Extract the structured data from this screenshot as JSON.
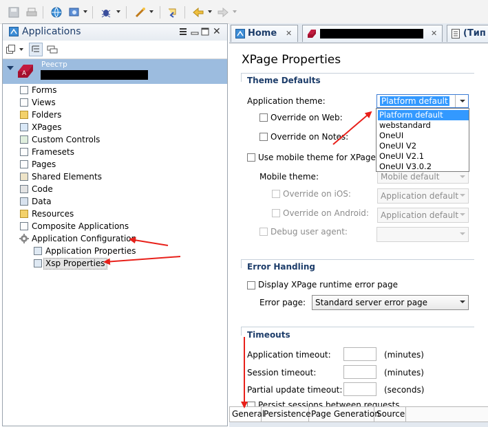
{
  "left_panel": {
    "title": "Applications",
    "app_node": {
      "label": "Реестр"
    },
    "tree_items": [
      {
        "label": "Forms"
      },
      {
        "label": "Views"
      },
      {
        "label": "Folders"
      },
      {
        "label": "XPages"
      },
      {
        "label": "Custom Controls"
      },
      {
        "label": "Framesets"
      },
      {
        "label": "Pages"
      },
      {
        "label": "Shared Elements"
      },
      {
        "label": "Code"
      },
      {
        "label": "Data"
      },
      {
        "label": "Resources"
      },
      {
        "label": "Composite Applications"
      },
      {
        "label": "Application Configuration"
      }
    ],
    "sub_items": [
      {
        "label": "Application Properties"
      },
      {
        "label": "Xsp Properties"
      }
    ]
  },
  "editor_tabs": [
    {
      "label": "Home"
    },
    {
      "label": "(Тип"
    }
  ],
  "page": {
    "title": "XPage Properties",
    "theme_defaults": {
      "title": "Theme Defaults",
      "app_theme_label": "Application theme:",
      "app_theme_value": "Platform default",
      "override_web": "Override on Web:",
      "override_notes": "Override on Notes:",
      "use_mobile": "Use mobile theme for XPages wi",
      "mobile_theme_label": "Mobile theme:",
      "mobile_theme_value": "Mobile default",
      "override_ios": "Override on iOS:",
      "override_ios_value": "Application default",
      "override_android": "Override on Android:",
      "override_android_value": "Application default",
      "debug_agent": "Debug user agent:",
      "theme_options": [
        "Platform default",
        "webstandard",
        "OneUI",
        "OneUI V2",
        "OneUI V2.1",
        "OneUI V3.0.2"
      ]
    },
    "error_handling": {
      "title": "Error Handling",
      "display_label": "Display XPage runtime error page",
      "error_page_label": "Error page:",
      "error_page_value": "Standard server error page"
    },
    "timeouts": {
      "title": "Timeouts",
      "app_timeout": "Application timeout:",
      "session_timeout": "Session timeout:",
      "partial_timeout": "Partial update timeout:",
      "unit_minutes": "(minutes)",
      "unit_seconds": "(seconds)",
      "persist": "Persist sessions between requests"
    }
  },
  "bottom_tabs": [
    "General",
    "Persistence",
    "Page Generation",
    "Source"
  ],
  "colors": {
    "annotation_arrow": "#e8201a",
    "selection": "#3399ff",
    "section_title": "#1d3d6a"
  }
}
